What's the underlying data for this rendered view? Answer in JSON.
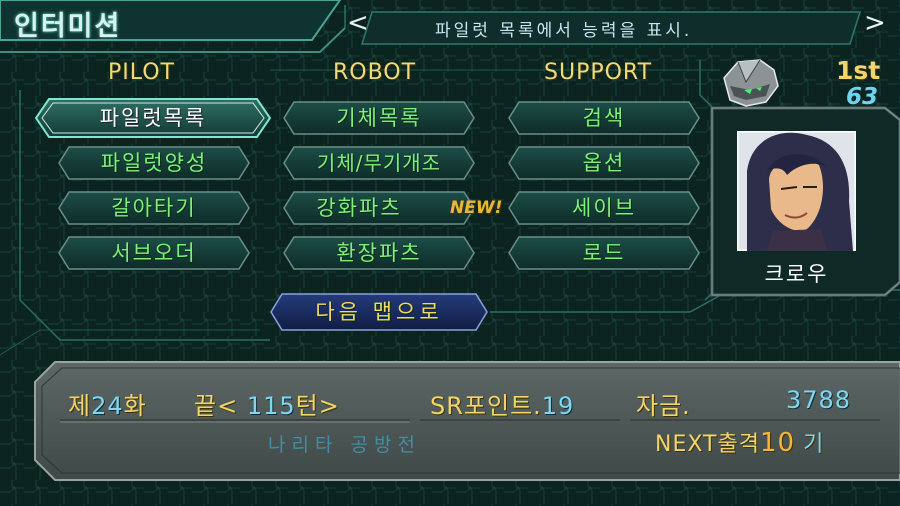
{
  "screen_title": "인터미션",
  "help_text": "파일럿 목록에서 능력을 표시.",
  "nav_left": "<",
  "nav_right": ">",
  "columns": {
    "pilot": "PILOT",
    "robot": "ROBOT",
    "support": "SUPPORT"
  },
  "pilot_menu": [
    "파일럿목록",
    "파일럿양성",
    "갈아타기",
    "서브오더"
  ],
  "robot_menu": [
    "기체목록",
    "기체/무기개조",
    "강화파츠",
    "환장파츠"
  ],
  "support_menu": [
    "검색",
    "옵션",
    "세이브",
    "로드"
  ],
  "new_badge": "NEW!",
  "next_map_button": "다음 맵으로",
  "selected_item": "파일럿목록",
  "rank": {
    "label": "1st",
    "value": "63"
  },
  "pilot": {
    "name": "크로우"
  },
  "status": {
    "episode_prefix": "제",
    "episode_num": "24",
    "episode_suffix": "화",
    "end_prefix": "끝<",
    "end_num": "115",
    "end_suffix": "턴>",
    "sr_label": "SR포인트.",
    "sr_value": "19",
    "money_label": "자금.",
    "money_value": "3788",
    "map_name": "나리타 공방전",
    "next_label": "NEXT출격",
    "next_value": "10",
    "next_unit": "기"
  },
  "colors": {
    "accent_green": "#7ef07a",
    "accent_gold": "#f1d46a",
    "accent_blue": "#7fd6ee",
    "background": "#0c2420"
  }
}
